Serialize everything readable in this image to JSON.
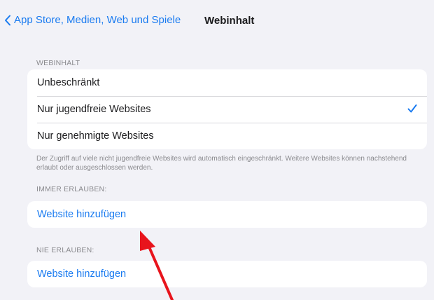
{
  "navbar": {
    "back_label": "App Store, Medien, Web und Spiele",
    "title": "Webinhalt"
  },
  "webinhalt": {
    "header": "WEBINHALT",
    "options": [
      {
        "label": "Unbeschränkt",
        "selected": false
      },
      {
        "label": "Nur jugendfreie Websites",
        "selected": true
      },
      {
        "label": "Nur genehmigte Websites",
        "selected": false
      }
    ],
    "footer": "Der Zugriff auf viele nicht jugendfreie Websites wird automatisch eingeschränkt. Weitere Websites können nachstehend erlaubt oder ausgeschlossen werden."
  },
  "always_allow": {
    "header": "IMMER ERLAUBEN:",
    "add_label": "Website hinzufügen"
  },
  "never_allow": {
    "header": "NIE ERLAUBEN:",
    "add_label": "Website hinzufügen"
  },
  "colors": {
    "accent": "#1a7bf0",
    "background": "#f2f2f7",
    "annotation_arrow": "#e8141c"
  },
  "icons": {
    "back": "chevron-left-icon",
    "selected": "checkmark-icon"
  }
}
